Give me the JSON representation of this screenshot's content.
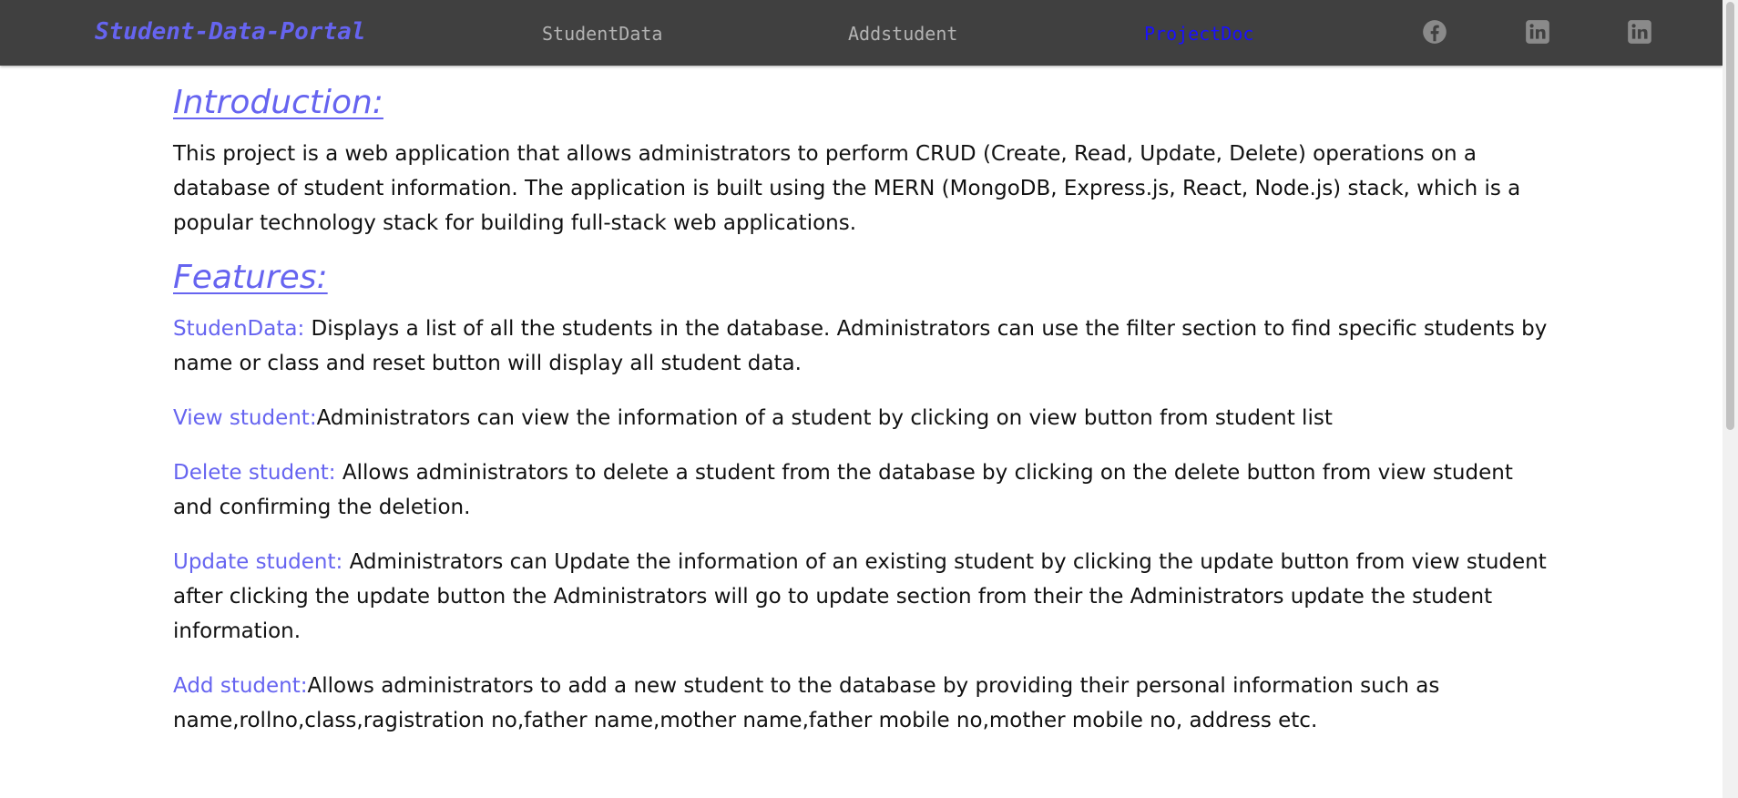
{
  "navbar": {
    "brand": "Student-Data-Portal",
    "links": [
      {
        "label": "StudentData",
        "active": false
      },
      {
        "label": "Addstudent",
        "active": false
      },
      {
        "label": "ProjectDoc",
        "active": true
      }
    ],
    "social_icons": [
      "facebook-icon",
      "linkedin-icon",
      "linkedin-icon"
    ]
  },
  "colors": {
    "navbar_bg": "#404040",
    "accent": "#6664f0",
    "active_link": "#1a10ff",
    "inactive_link": "#b3b3b3"
  },
  "intro": {
    "heading": "Introduction:",
    "text": "This project is a web application that allows administrators to perform CRUD (Create, Read, Update, Delete) operations on a database of student information. The application is built using the MERN (MongoDB, Express.js, React, Node.js) stack, which is a popular technology stack for building full-stack web applications."
  },
  "features": {
    "heading": "Features:",
    "items": [
      {
        "label": "StudenData:",
        "text": " Displays a list of all the students in the database. Administrators can use the filter section to find specific students by name or class and reset button will display all student data."
      },
      {
        "label": "View student:",
        "text": "Administrators can view the information of a student by clicking on view button from student list"
      },
      {
        "label": "Delete student:",
        "text": " Allows administrators to delete a student from the database by clicking on the delete button from view student and confirming the deletion."
      },
      {
        "label": "Update student:",
        "text": " Administrators can Update the information of an existing student by clicking the update button from view student after clicking the update button the Administrators will go to update section from their the Administrators update the student information."
      },
      {
        "label": "Add student:",
        "text": "Allows administrators to add a new student to the database by providing their personal information such as name,rollno,class,ragistration no,father name,mother name,father mobile no,mother mobile no, address etc."
      }
    ]
  }
}
